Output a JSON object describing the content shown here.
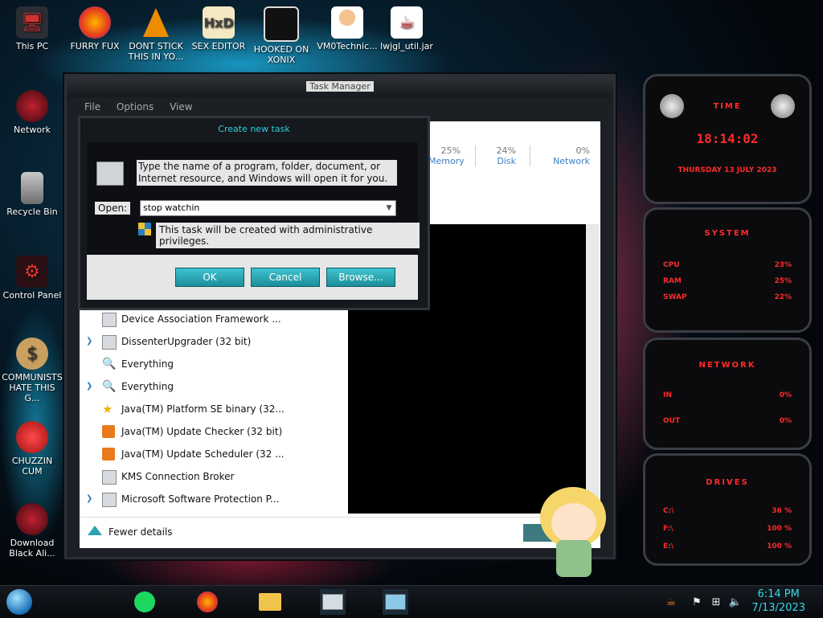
{
  "desktop": {
    "icons": [
      {
        "label": "This PC",
        "icon": "computer-icon"
      },
      {
        "label": "FURRY FUX",
        "icon": "firefox-icon"
      },
      {
        "label": "DONT STICK THIS IN YO...",
        "icon": "vlc-icon"
      },
      {
        "label": "SEX EDITOR",
        "icon": "hxd-icon"
      },
      {
        "label": "HOOKED ON XONIX",
        "icon": "xonix-icon"
      },
      {
        "label": "VM0Technic...",
        "icon": "doctor-icon"
      },
      {
        "label": "lwjgl_util.jar",
        "icon": "java-icon"
      },
      {
        "label": "Network",
        "icon": "network-icon"
      },
      {
        "label": "Recycle Bin",
        "icon": "recycle-bin-icon"
      },
      {
        "label": "Control Panel",
        "icon": "control-panel-icon"
      },
      {
        "label": "COMMUNISTS HATE THIS G...",
        "icon": "money-bag-icon"
      },
      {
        "label": "CHUZZIN CUM",
        "icon": "chuzzle-icon"
      },
      {
        "label": "Download Black Ali...",
        "icon": "alien-icon"
      }
    ]
  },
  "task_manager": {
    "title": "Task Manager",
    "menu": [
      "File",
      "Options",
      "View"
    ],
    "columns": [
      {
        "pct": "25%",
        "label": "Memory"
      },
      {
        "pct": "24%",
        "label": "Disk"
      },
      {
        "pct": "0%",
        "label": "Network"
      }
    ],
    "processes": [
      {
        "name": "Device Association Framework ...",
        "expand": false,
        "icon": "window-icon"
      },
      {
        "name": "DissenterUpgrader (32 bit)",
        "expand": true,
        "icon": "window-icon"
      },
      {
        "name": "Everything",
        "expand": false,
        "icon": "magnifier-icon"
      },
      {
        "name": "Everything",
        "expand": true,
        "icon": "magnifier-icon"
      },
      {
        "name": "Java(TM) Platform SE binary (32...",
        "expand": false,
        "icon": "java-star-icon"
      },
      {
        "name": "Java(TM) Update Checker (32 bit)",
        "expand": false,
        "icon": "java-update-icon"
      },
      {
        "name": "Java(TM) Update Scheduler (32 ...",
        "expand": false,
        "icon": "java-update-icon"
      },
      {
        "name": "KMS Connection Broker",
        "expand": false,
        "icon": "window-icon"
      },
      {
        "name": "Microsoft Software Protection P...",
        "expand": true,
        "icon": "window-icon"
      }
    ],
    "fewer_details": "Fewer details"
  },
  "run_dialog": {
    "title": "Create new task",
    "message": "Type the name of a program, folder, document, or Internet resource, and Windows will open it for you.",
    "open_label": "Open:",
    "open_value": "stop watchin",
    "admin_note": "This task will be created with administrative privileges.",
    "ok": "OK",
    "cancel": "Cancel",
    "browse": "Browse..."
  },
  "widget": {
    "time_title": "TIME",
    "time": "18:14:02",
    "date": "THURSDAY 13 JULY 2023",
    "system_title": "SYSTEM",
    "system": [
      {
        "label": "CPU",
        "value": "23%"
      },
      {
        "label": "RAM",
        "value": "25%"
      },
      {
        "label": "SWAP",
        "value": "22%"
      }
    ],
    "network_title": "NETWORK",
    "network": [
      {
        "label": "IN",
        "value": "0%"
      },
      {
        "label": "OUT",
        "value": "0%"
      }
    ],
    "drives_title": "DRIVES",
    "drives": [
      {
        "label": "C:\\",
        "value": "36 %"
      },
      {
        "label": "F:\\",
        "value": "100 %"
      },
      {
        "label": "E:\\",
        "value": "100 %"
      }
    ]
  },
  "taskbar": {
    "time": "6:14 PM",
    "date": "7/13/2023",
    "colors": {
      "accent": "#36d8e8",
      "alert": "#ff2a2a"
    }
  }
}
